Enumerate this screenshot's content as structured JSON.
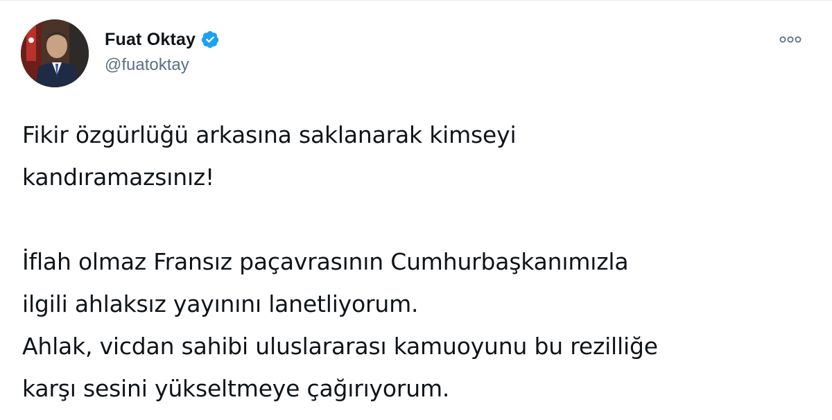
{
  "author": {
    "display_name": "Fuat Oktay",
    "handle": "@fuatoktay",
    "verified": true,
    "verified_icon": "verified-badge-icon",
    "avatar": "profile-photo"
  },
  "menu": {
    "icon": "more-options-icon"
  },
  "tweet": {
    "paragraphs": [
      {
        "lines": [
          "Fikir özgürlüğü arkasına saklanarak kimseyi",
          "kandıramazsınız!"
        ]
      },
      {
        "lines": [
          "İflah olmaz Fransız paçavrasının Cumhurbaşkanımızla",
          "ilgili ahlaksız yayınını lanetliyorum.",
          "Ahlak, vicdan sahibi uluslararası kamuoyunu bu rezilliğe",
          "karşı sesini yükseltmeye çağırıyorum."
        ]
      }
    ]
  },
  "colors": {
    "text": "#0f1419",
    "secondary": "#5b7083",
    "verified_blue": "#1da1f2",
    "border": "#e6ecf0"
  }
}
